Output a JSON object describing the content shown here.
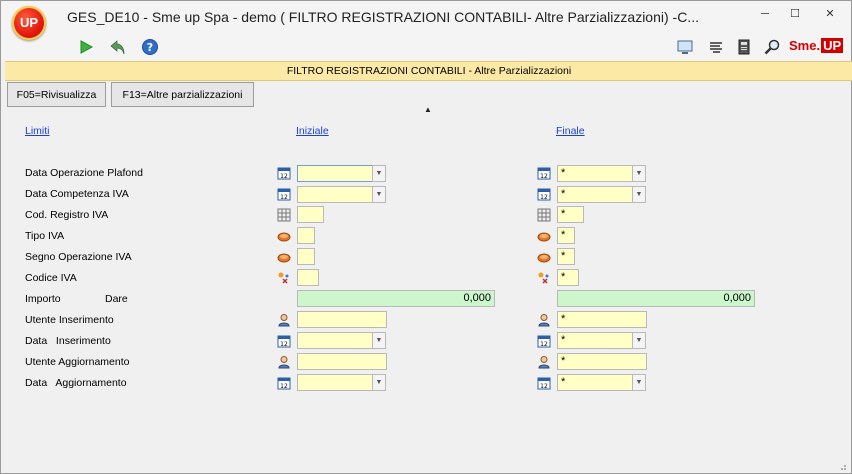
{
  "window": {
    "title": "GES_DE10 - Sme up Spa       - demo ( FILTRO REGISTRAZIONI CONTABILI- Altre Parzializzazioni) -C...",
    "logo_text": "UP",
    "minimize": "─",
    "maximize": "☐",
    "close": "✕"
  },
  "toolbar": {
    "brand": "Sme.",
    "brand_box": "UP"
  },
  "panel": {
    "header": "FILTRO REGISTRAZIONI CONTABILI -  Altre Parzializzazioni"
  },
  "buttons": {
    "f05": "F05=Rivisualizza",
    "f13": "F13=Altre parzializzazioni"
  },
  "columns": {
    "limiti": "Limiti",
    "iniziale": "Iniziale",
    "finale": "Finale"
  },
  "rows": [
    {
      "label": "Data Operazione Plafond",
      "icon": "calendar-icon",
      "initial": "",
      "final": "*"
    },
    {
      "label": "Data Competenza IVA",
      "icon": "calendar-icon",
      "initial": "",
      "final": "*"
    },
    {
      "label": "Cod. Registro IVA",
      "icon": "grid-icon",
      "initial": "",
      "final": "*"
    },
    {
      "label": "Tipo IVA",
      "icon": "token-icon",
      "initial": "",
      "final": "*"
    },
    {
      "label": "Segno Operazione IVA",
      "icon": "token-icon",
      "initial": "",
      "final": "*"
    },
    {
      "label": "Codice IVA",
      "icon": "sparkle-icon",
      "initial": "",
      "final": "*"
    },
    {
      "label": "Importo",
      "sublabel": "Dare",
      "icon": "",
      "initial": "0,000",
      "final": "0,000"
    },
    {
      "label": "Utente Inserimento",
      "icon": "user-icon",
      "initial": "",
      "final": "*"
    },
    {
      "label": "Data   Inserimento",
      "icon": "calendar-icon",
      "initial": "",
      "final": "*"
    },
    {
      "label": "Utente Aggiornamento",
      "icon": "user-icon",
      "initial": "",
      "final": "*"
    },
    {
      "label": "Data   Aggiornamento",
      "icon": "calendar-icon",
      "initial": "",
      "final": "*"
    }
  ],
  "colors": {
    "field": "#ffffc6",
    "amount": "#ccf7cc",
    "header": "#fde9a6",
    "link": "#1a3fd6"
  }
}
